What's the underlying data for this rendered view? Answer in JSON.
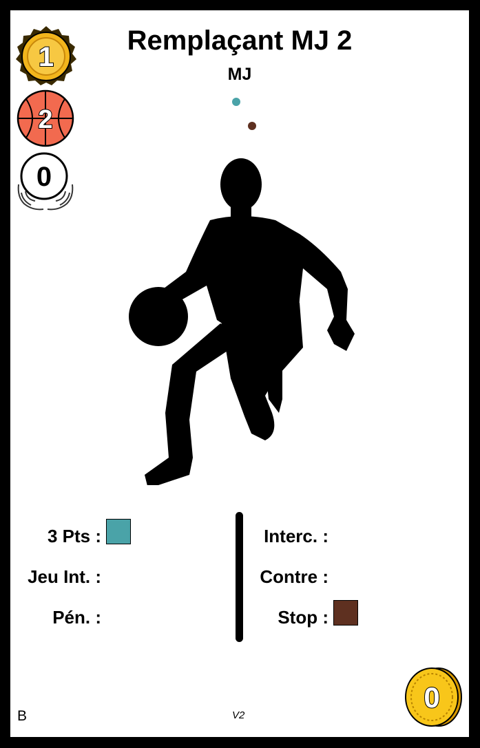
{
  "card": {
    "title": "Remplaçant MJ 2",
    "subtitle": "MJ",
    "dot_colors": [
      "#4AA3A8",
      "#5E3020"
    ],
    "badges": {
      "gold_medal": {
        "value": "1",
        "icon": "gold-medal-icon",
        "color": "#F2B51C"
      },
      "basketball": {
        "value": "2",
        "icon": "basketball-icon",
        "color": "#F26A4F"
      },
      "hands": {
        "value": "0",
        "icon": "open-hands-icon"
      }
    },
    "coin": {
      "value": "0",
      "icon": "gold-coin-icon",
      "color": "#F8C61A"
    },
    "illustration": "basketball-player-silhouette",
    "stats_left": [
      {
        "label": "3 Pts :",
        "swatch": "#4AA3A8"
      },
      {
        "label": "Jeu Int. :",
        "swatch": null
      },
      {
        "label": "Pén. :",
        "swatch": null
      }
    ],
    "stats_right": [
      {
        "label": "Interc. :",
        "swatch": null
      },
      {
        "label": "Contre :",
        "swatch": null
      },
      {
        "label": "Stop :",
        "swatch": "#5E3020"
      }
    ],
    "footer_left": "B",
    "version": "V2"
  }
}
